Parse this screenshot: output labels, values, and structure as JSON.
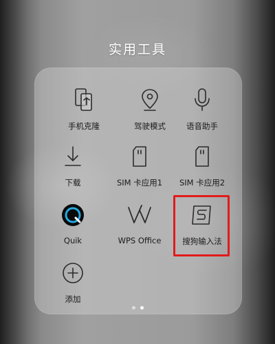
{
  "folder": {
    "title": "实用工具"
  },
  "apps": [
    {
      "label": "手机克隆",
      "icon": "phone-clone-icon"
    },
    {
      "label": "驾驶模式",
      "icon": "location-pin-icon"
    },
    {
      "label": "语音助手",
      "icon": "microphone-icon"
    },
    {
      "label": "下载",
      "icon": "download-icon"
    },
    {
      "label": "SIM 卡应用1",
      "icon": "sim-card-icon"
    },
    {
      "label": "SIM 卡应用2",
      "icon": "sim-card-icon"
    },
    {
      "label": "Quik",
      "icon": "quik-logo-icon"
    },
    {
      "label": "WPS Office",
      "icon": "wps-logo-icon"
    },
    {
      "label": "搜狗输入法",
      "icon": "sogou-logo-icon"
    },
    {
      "label": "添加",
      "icon": "add-circle-icon"
    }
  ],
  "pagination": {
    "pages": 2,
    "current": 2
  },
  "colors": {
    "highlight": "#e21b1b"
  }
}
